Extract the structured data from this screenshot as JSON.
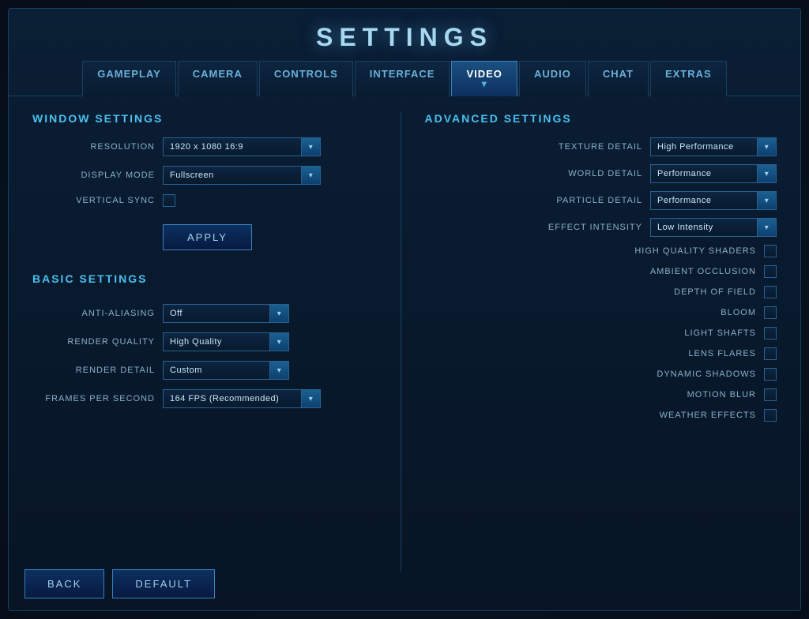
{
  "title": "SETTINGS",
  "tabs": [
    {
      "id": "gameplay",
      "label": "GAMEPLAY",
      "active": false
    },
    {
      "id": "camera",
      "label": "CAMERA",
      "active": false
    },
    {
      "id": "controls",
      "label": "CONTROLS",
      "active": false
    },
    {
      "id": "interface",
      "label": "INTERFACE",
      "active": false
    },
    {
      "id": "video",
      "label": "VIDEO",
      "active": true
    },
    {
      "id": "audio",
      "label": "AUDIO",
      "active": false
    },
    {
      "id": "chat",
      "label": "CHAT",
      "active": false
    },
    {
      "id": "extras",
      "label": "EXTRAS",
      "active": false
    }
  ],
  "window_settings": {
    "title": "WINDOW SETTINGS",
    "resolution": {
      "label": "RESOLUTION",
      "value": "1920 x 1080 16:9"
    },
    "display_mode": {
      "label": "DISPLAY MODE",
      "value": "Fullscreen"
    },
    "vertical_sync": {
      "label": "VERTICAL SYNC"
    },
    "apply_button": "APPLY"
  },
  "basic_settings": {
    "title": "BASIC SETTINGS",
    "anti_aliasing": {
      "label": "ANTI-ALIASING",
      "value": "Off"
    },
    "render_quality": {
      "label": "RENDER QUALITY",
      "value": "High Quality"
    },
    "render_detail": {
      "label": "RENDER DETAIL",
      "value": "Custom"
    },
    "fps": {
      "label": "FRAMES PER SECOND",
      "value": "164 FPS (Recommended)"
    }
  },
  "advanced_settings": {
    "title": "ADVANCED SETTINGS",
    "texture_detail": {
      "label": "TEXTURE DETAIL",
      "value": "High Performance"
    },
    "world_detail": {
      "label": "WORLD DETAIL",
      "value": "Performance"
    },
    "particle_detail": {
      "label": "PARTICLE DETAIL",
      "value": "Performance"
    },
    "effect_intensity": {
      "label": "EFFECT INTENSITY",
      "value": "Low Intensity"
    },
    "high_quality_shaders": {
      "label": "HIGH QUALITY SHADERS",
      "checked": false
    },
    "ambient_occlusion": {
      "label": "AMBIENT OCCLUSION",
      "checked": false
    },
    "depth_of_field": {
      "label": "DEPTH OF FIELD",
      "checked": false
    },
    "bloom": {
      "label": "BLOOM",
      "checked": false
    },
    "light_shafts": {
      "label": "LIGHT SHAFTS",
      "checked": false
    },
    "lens_flares": {
      "label": "LENS FLARES",
      "checked": false
    },
    "dynamic_shadows": {
      "label": "DYNAMIC SHADOWS",
      "checked": false
    },
    "motion_blur": {
      "label": "MOTION BLUR",
      "checked": false
    },
    "weather_effects": {
      "label": "WEATHER EFFECTS",
      "checked": false
    }
  },
  "bottom": {
    "back_label": "BACK",
    "default_label": "DEFAULT"
  }
}
